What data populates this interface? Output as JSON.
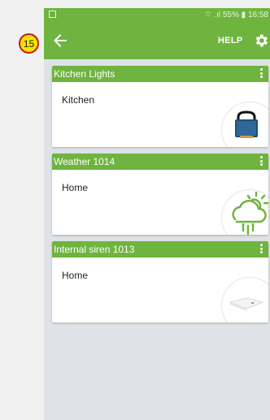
{
  "annotation": {
    "step_number": "15"
  },
  "status_bar": {
    "battery_text": "55%",
    "time": "16:58"
  },
  "toolbar": {
    "help_label": "HELP"
  },
  "devices": [
    {
      "title": "Kitchen Lights",
      "room": "Kitchen",
      "icon": "switch-module-icon"
    },
    {
      "title": "Weather 1014",
      "room": "Home",
      "icon": "weather-cloud-sun-icon"
    },
    {
      "title": "Internal siren 1013",
      "room": "Home",
      "icon": "siren-device-icon"
    }
  ],
  "colors": {
    "accent_green": "#6eb43f",
    "background": "#dfe2e6",
    "badge_yellow": "#f7e400",
    "badge_border": "#c51c1c"
  }
}
